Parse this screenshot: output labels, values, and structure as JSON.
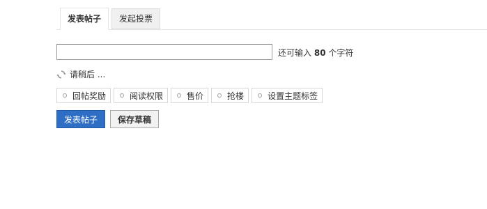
{
  "tabs": [
    {
      "label": "发表帖子",
      "active": true
    },
    {
      "label": "发起投票",
      "active": false
    }
  ],
  "title_input": {
    "value": "",
    "placeholder": ""
  },
  "limit": {
    "prefix": "还可输入",
    "count": "80",
    "suffix": "个字符"
  },
  "loading_text": "请稍后 ...",
  "options": [
    {
      "label": "回帖奖励",
      "icon": "circle-icon"
    },
    {
      "label": "阅读权限",
      "icon": "circle-icon"
    },
    {
      "label": "售价",
      "icon": "circle-icon"
    },
    {
      "label": "抢楼",
      "icon": "circle-icon"
    },
    {
      "label": "设置主题标签",
      "icon": "circle-icon"
    }
  ],
  "buttons": {
    "submit": "发表帖子",
    "save_draft": "保存草稿"
  },
  "colors": {
    "primary": "#2e6ec4",
    "border": "#e3e3e3"
  }
}
